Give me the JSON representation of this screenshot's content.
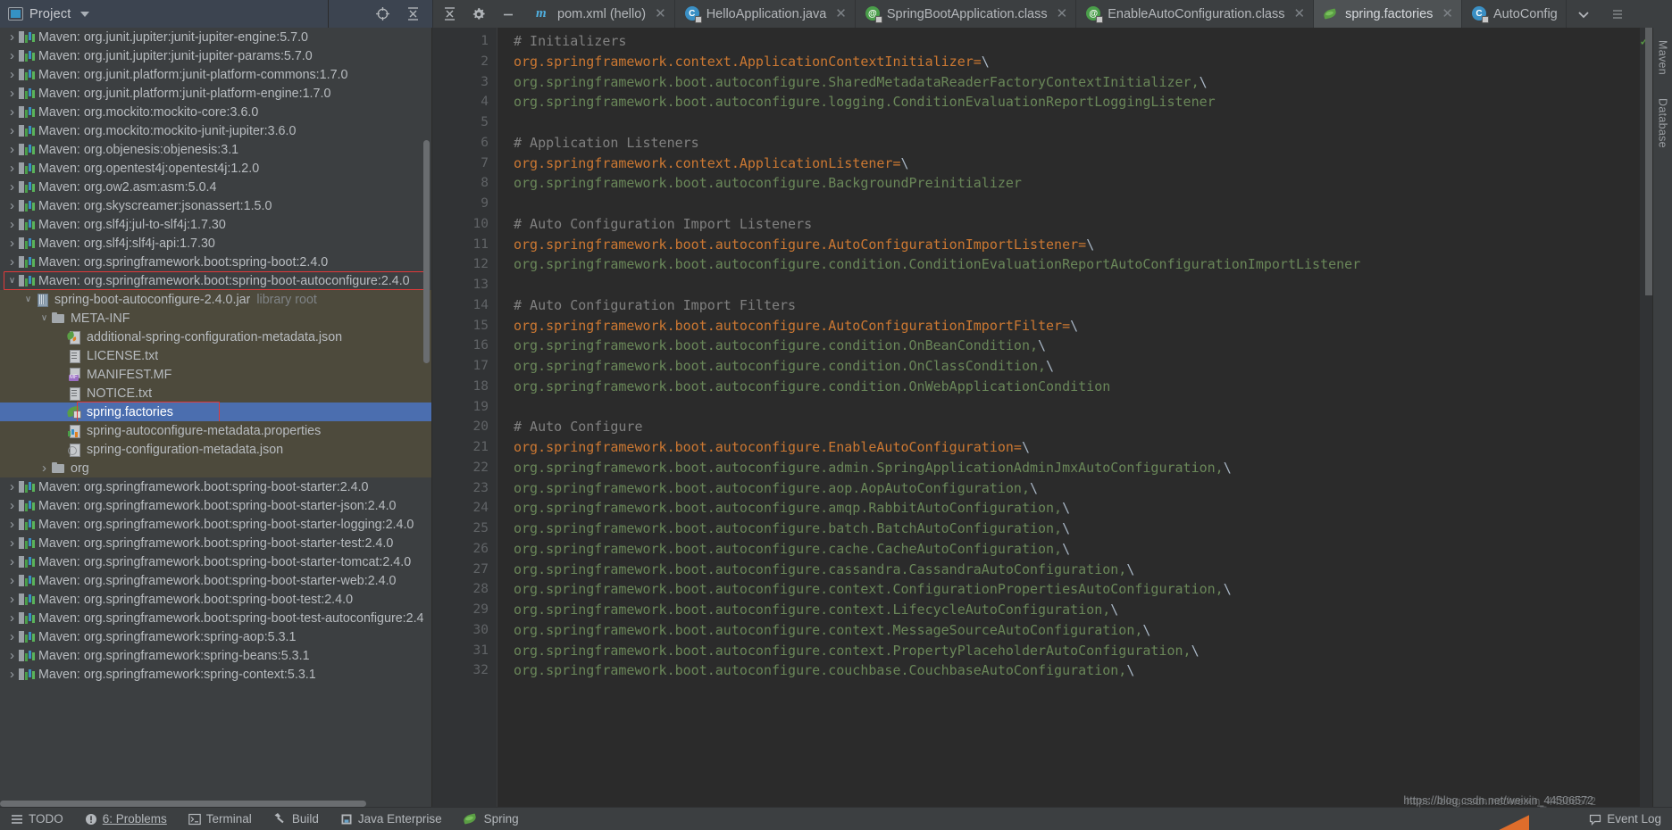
{
  "window": {
    "project_panel": {
      "title": "Project",
      "icons": [
        "project-icon",
        "chevron-down-icon",
        "locate-icon",
        "collapse-all-icon"
      ]
    },
    "toolbar_icons": [
      "settings-gear-icon",
      "minimize-icon"
    ]
  },
  "editor_tabs": [
    {
      "label": "pom.xml (hello)",
      "icon": "maven-m-icon",
      "active": false,
      "closable": true
    },
    {
      "label": "HelloApplication.java",
      "icon": "java-class-icon",
      "active": false,
      "closable": true
    },
    {
      "label": "SpringBootApplication.class",
      "icon": "annotation-class-icon",
      "active": false,
      "closable": true
    },
    {
      "label": "EnableAutoConfiguration.class",
      "icon": "annotation-class-icon",
      "active": false,
      "closable": true
    },
    {
      "label": "spring.factories",
      "icon": "spring-leaf-icon",
      "active": true,
      "closable": true
    },
    {
      "label": "AutoConfig",
      "icon": "java-class-icon",
      "active": false,
      "closable": false
    }
  ],
  "tree": [
    {
      "indent": 0,
      "arrow": "collapsed",
      "icon": "maven-icon",
      "label": "Maven: org.junit.jupiter:junit-jupiter-engine:5.7.0"
    },
    {
      "indent": 0,
      "arrow": "collapsed",
      "icon": "maven-icon",
      "label": "Maven: org.junit.jupiter:junit-jupiter-params:5.7.0"
    },
    {
      "indent": 0,
      "arrow": "collapsed",
      "icon": "maven-icon",
      "label": "Maven: org.junit.platform:junit-platform-commons:1.7.0"
    },
    {
      "indent": 0,
      "arrow": "collapsed",
      "icon": "maven-icon",
      "label": "Maven: org.junit.platform:junit-platform-engine:1.7.0"
    },
    {
      "indent": 0,
      "arrow": "collapsed",
      "icon": "maven-icon",
      "label": "Maven: org.mockito:mockito-core:3.6.0"
    },
    {
      "indent": 0,
      "arrow": "collapsed",
      "icon": "maven-icon",
      "label": "Maven: org.mockito:mockito-junit-jupiter:3.6.0"
    },
    {
      "indent": 0,
      "arrow": "collapsed",
      "icon": "maven-icon",
      "label": "Maven: org.objenesis:objenesis:3.1"
    },
    {
      "indent": 0,
      "arrow": "collapsed",
      "icon": "maven-icon",
      "label": "Maven: org.opentest4j:opentest4j:1.2.0"
    },
    {
      "indent": 0,
      "arrow": "collapsed",
      "icon": "maven-icon",
      "label": "Maven: org.ow2.asm:asm:5.0.4"
    },
    {
      "indent": 0,
      "arrow": "collapsed",
      "icon": "maven-icon",
      "label": "Maven: org.skyscreamer:jsonassert:1.5.0"
    },
    {
      "indent": 0,
      "arrow": "collapsed",
      "icon": "maven-icon",
      "label": "Maven: org.slf4j:jul-to-slf4j:1.7.30"
    },
    {
      "indent": 0,
      "arrow": "collapsed",
      "icon": "maven-icon",
      "label": "Maven: org.slf4j:slf4j-api:1.7.30"
    },
    {
      "indent": 0,
      "arrow": "collapsed",
      "icon": "maven-icon",
      "label": "Maven: org.springframework.boot:spring-boot:2.4.0"
    },
    {
      "indent": 0,
      "arrow": "expanded",
      "icon": "maven-icon",
      "label": "Maven: org.springframework.boot:spring-boot-autoconfigure:2.4.0",
      "highlight_box": true
    },
    {
      "indent": 1,
      "arrow": "expanded",
      "icon": "jar-icon",
      "label": "spring-boot-autoconfigure-2.4.0.jar",
      "sub": "library root",
      "in_jar": true
    },
    {
      "indent": 2,
      "arrow": "expanded",
      "icon": "folder-icon",
      "label": "META-INF",
      "in_jar": true
    },
    {
      "indent": 3,
      "arrow": "none",
      "icon": "spring-json-icon",
      "label": "additional-spring-configuration-metadata.json",
      "in_jar": true
    },
    {
      "indent": 3,
      "arrow": "none",
      "icon": "text-file-icon",
      "label": "LICENSE.txt",
      "in_jar": true
    },
    {
      "indent": 3,
      "arrow": "none",
      "icon": "manifest-file-icon",
      "label": "MANIFEST.MF",
      "in_jar": true
    },
    {
      "indent": 3,
      "arrow": "none",
      "icon": "text-file-icon",
      "label": "NOTICE.txt",
      "in_jar": true
    },
    {
      "indent": 3,
      "arrow": "none",
      "icon": "spring-leaf-icon",
      "label": "spring.factories",
      "selected": true,
      "highlight_box": true
    },
    {
      "indent": 3,
      "arrow": "none",
      "icon": "properties-file-icon",
      "label": "spring-autoconfigure-metadata.properties",
      "in_jar": true
    },
    {
      "indent": 3,
      "arrow": "none",
      "icon": "config-json-icon",
      "label": "spring-configuration-metadata.json",
      "in_jar": true
    },
    {
      "indent": 2,
      "arrow": "collapsed",
      "icon": "folder-icon",
      "label": "org",
      "in_jar": true
    },
    {
      "indent": 0,
      "arrow": "collapsed",
      "icon": "maven-icon",
      "label": "Maven: org.springframework.boot:spring-boot-starter:2.4.0"
    },
    {
      "indent": 0,
      "arrow": "collapsed",
      "icon": "maven-icon",
      "label": "Maven: org.springframework.boot:spring-boot-starter-json:2.4.0"
    },
    {
      "indent": 0,
      "arrow": "collapsed",
      "icon": "maven-icon",
      "label": "Maven: org.springframework.boot:spring-boot-starter-logging:2.4.0"
    },
    {
      "indent": 0,
      "arrow": "collapsed",
      "icon": "maven-icon",
      "label": "Maven: org.springframework.boot:spring-boot-starter-test:2.4.0"
    },
    {
      "indent": 0,
      "arrow": "collapsed",
      "icon": "maven-icon",
      "label": "Maven: org.springframework.boot:spring-boot-starter-tomcat:2.4.0"
    },
    {
      "indent": 0,
      "arrow": "collapsed",
      "icon": "maven-icon",
      "label": "Maven: org.springframework.boot:spring-boot-starter-web:2.4.0"
    },
    {
      "indent": 0,
      "arrow": "collapsed",
      "icon": "maven-icon",
      "label": "Maven: org.springframework.boot:spring-boot-test:2.4.0"
    },
    {
      "indent": 0,
      "arrow": "collapsed",
      "icon": "maven-icon",
      "label": "Maven: org.springframework.boot:spring-boot-test-autoconfigure:2.4"
    },
    {
      "indent": 0,
      "arrow": "collapsed",
      "icon": "maven-icon",
      "label": "Maven: org.springframework:spring-aop:5.3.1"
    },
    {
      "indent": 0,
      "arrow": "collapsed",
      "icon": "maven-icon",
      "label": "Maven: org.springframework:spring-beans:5.3.1"
    },
    {
      "indent": 0,
      "arrow": "collapsed",
      "icon": "maven-icon",
      "label": "Maven: org.springframework:spring-context:5.3.1"
    }
  ],
  "editor": {
    "first_line_number": 1,
    "lines": [
      {
        "n": 1,
        "parts": [
          {
            "t": "# Initializers",
            "c": "comment"
          }
        ]
      },
      {
        "n": 2,
        "parts": [
          {
            "t": "org.springframework.context.ApplicationContextInitializer",
            "c": "key"
          },
          {
            "t": "=",
            "c": "key"
          },
          {
            "t": "\\",
            "c": "esc"
          }
        ]
      },
      {
        "n": 3,
        "parts": [
          {
            "t": "org.springframework.boot.autoconfigure.SharedMetadataReaderFactoryContextInitializer,",
            "c": "val"
          },
          {
            "t": "\\",
            "c": "esc"
          }
        ]
      },
      {
        "n": 4,
        "parts": [
          {
            "t": "org.springframework.boot.autoconfigure.logging.ConditionEvaluationReportLoggingListener",
            "c": "val"
          }
        ]
      },
      {
        "n": 5,
        "parts": []
      },
      {
        "n": 6,
        "parts": [
          {
            "t": "# Application Listeners",
            "c": "comment"
          }
        ]
      },
      {
        "n": 7,
        "parts": [
          {
            "t": "org.springframework.context.ApplicationListener",
            "c": "key"
          },
          {
            "t": "=",
            "c": "key"
          },
          {
            "t": "\\",
            "c": "esc"
          }
        ]
      },
      {
        "n": 8,
        "parts": [
          {
            "t": "org.springframework.boot.autoconfigure.BackgroundPreinitializer",
            "c": "val"
          }
        ]
      },
      {
        "n": 9,
        "parts": []
      },
      {
        "n": 10,
        "parts": [
          {
            "t": "# Auto Configuration Import Listeners",
            "c": "comment"
          }
        ]
      },
      {
        "n": 11,
        "parts": [
          {
            "t": "org.springframework.boot.autoconfigure.AutoConfigurationImportListener",
            "c": "key"
          },
          {
            "t": "=",
            "c": "key"
          },
          {
            "t": "\\",
            "c": "esc"
          }
        ]
      },
      {
        "n": 12,
        "parts": [
          {
            "t": "org.springframework.boot.autoconfigure.condition.ConditionEvaluationReportAutoConfigurationImportListener",
            "c": "val"
          }
        ]
      },
      {
        "n": 13,
        "parts": []
      },
      {
        "n": 14,
        "parts": [
          {
            "t": "# Auto Configuration Import Filters",
            "c": "comment"
          }
        ]
      },
      {
        "n": 15,
        "parts": [
          {
            "t": "org.springframework.boot.autoconfigure.AutoConfigurationImportFilter",
            "c": "key"
          },
          {
            "t": "=",
            "c": "key"
          },
          {
            "t": "\\",
            "c": "esc"
          }
        ]
      },
      {
        "n": 16,
        "parts": [
          {
            "t": "org.springframework.boot.autoconfigure.condition.OnBeanCondition,",
            "c": "val"
          },
          {
            "t": "\\",
            "c": "esc"
          }
        ]
      },
      {
        "n": 17,
        "parts": [
          {
            "t": "org.springframework.boot.autoconfigure.condition.OnClassCondition,",
            "c": "val"
          },
          {
            "t": "\\",
            "c": "esc"
          }
        ]
      },
      {
        "n": 18,
        "parts": [
          {
            "t": "org.springframework.boot.autoconfigure.condition.OnWebApplicationCondition",
            "c": "val"
          }
        ]
      },
      {
        "n": 19,
        "parts": []
      },
      {
        "n": 20,
        "parts": [
          {
            "t": "# Auto Configure",
            "c": "comment"
          }
        ]
      },
      {
        "n": 21,
        "parts": [
          {
            "t": "org.springframework.boot.autoconfigure.EnableAutoConfiguration",
            "c": "key"
          },
          {
            "t": "=",
            "c": "key"
          },
          {
            "t": "\\",
            "c": "esc"
          }
        ]
      },
      {
        "n": 22,
        "parts": [
          {
            "t": "org.springframework.boot.autoconfigure.admin.SpringApplicationAdminJmxAutoConfiguration,",
            "c": "val"
          },
          {
            "t": "\\",
            "c": "esc"
          }
        ]
      },
      {
        "n": 23,
        "parts": [
          {
            "t": "org.springframework.boot.autoconfigure.aop.AopAutoConfiguration,",
            "c": "val"
          },
          {
            "t": "\\",
            "c": "esc"
          }
        ]
      },
      {
        "n": 24,
        "parts": [
          {
            "t": "org.springframework.boot.autoconfigure.amqp.RabbitAutoConfiguration,",
            "c": "val"
          },
          {
            "t": "\\",
            "c": "esc"
          }
        ]
      },
      {
        "n": 25,
        "parts": [
          {
            "t": "org.springframework.boot.autoconfigure.batch.BatchAutoConfiguration,",
            "c": "val"
          },
          {
            "t": "\\",
            "c": "esc"
          }
        ]
      },
      {
        "n": 26,
        "parts": [
          {
            "t": "org.springframework.boot.autoconfigure.cache.CacheAutoConfiguration,",
            "c": "val"
          },
          {
            "t": "\\",
            "c": "esc"
          }
        ]
      },
      {
        "n": 27,
        "parts": [
          {
            "t": "org.springframework.boot.autoconfigure.cassandra.CassandraAutoConfiguration,",
            "c": "val"
          },
          {
            "t": "\\",
            "c": "esc"
          }
        ]
      },
      {
        "n": 28,
        "parts": [
          {
            "t": "org.springframework.boot.autoconfigure.context.ConfigurationPropertiesAutoConfiguration,",
            "c": "val"
          },
          {
            "t": "\\",
            "c": "esc"
          }
        ]
      },
      {
        "n": 29,
        "parts": [
          {
            "t": "org.springframework.boot.autoconfigure.context.LifecycleAutoConfiguration,",
            "c": "val"
          },
          {
            "t": "\\",
            "c": "esc"
          }
        ]
      },
      {
        "n": 30,
        "parts": [
          {
            "t": "org.springframework.boot.autoconfigure.context.MessageSourceAutoConfiguration,",
            "c": "val"
          },
          {
            "t": "\\",
            "c": "esc"
          }
        ]
      },
      {
        "n": 31,
        "parts": [
          {
            "t": "org.springframework.boot.autoconfigure.context.PropertyPlaceholderAutoConfiguration,",
            "c": "val"
          },
          {
            "t": "\\",
            "c": "esc"
          }
        ]
      },
      {
        "n": 32,
        "parts": [
          {
            "t": "org.springframework.boot.autoconfigure.couchbase.CouchbaseAutoConfiguration,",
            "c": "val"
          },
          {
            "t": "\\",
            "c": "esc"
          }
        ]
      }
    ]
  },
  "right_strip": [
    "Maven",
    "Database"
  ],
  "statusbar": {
    "items": [
      {
        "label": "TODO",
        "icon": "todo-icon"
      },
      {
        "label": "6: Problems",
        "icon": "problems-icon",
        "underline_first": true
      },
      {
        "label": "Terminal",
        "icon": "terminal-icon"
      },
      {
        "label": "Build",
        "icon": "build-hammer-icon"
      },
      {
        "label": "Java Enterprise",
        "icon": "java-enterprise-icon"
      },
      {
        "label": "Spring",
        "icon": "spring-leaf-icon"
      }
    ],
    "right": {
      "label": "Event Log",
      "icon": "event-log-icon"
    }
  },
  "watermark": "https://blog.csdn.net/weixin_44506572",
  "colors": {
    "selection_blue": "#4b6eaf",
    "jar_background": "#4d4a3c",
    "highlight_red": "#e03a3a",
    "comment": "#808080",
    "key_orange": "#cc7832",
    "value_green": "#6a8759",
    "editor_bg": "#2b2b2b",
    "panel_bg": "#3c3f41"
  }
}
